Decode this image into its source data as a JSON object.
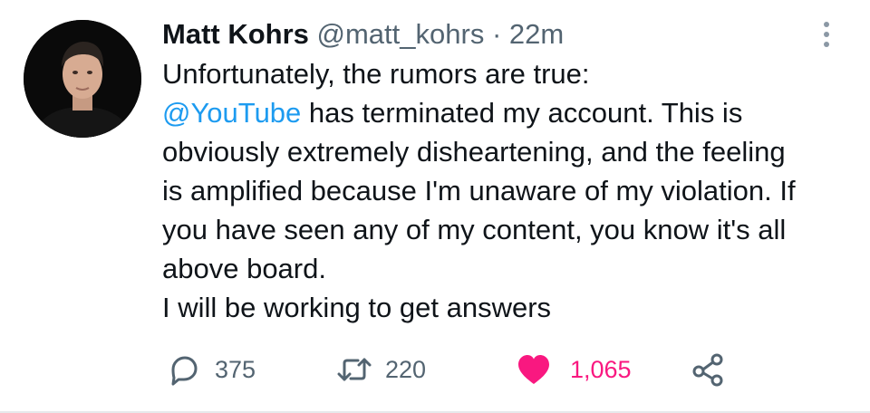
{
  "author": {
    "name": "Matt Kohrs",
    "handle": "@matt_kohrs",
    "separator": "·",
    "time": "22m"
  },
  "tweet": {
    "line1": "Unfortunately, the rumors are true:",
    "mention": "@YouTube",
    "line2_rest": " has terminated my account. This is",
    "line3": "obviously extremely disheartening, and the feeling",
    "line4": "is amplified because I'm unaware of my violation. If",
    "line5": "you have seen any of my content, you know it's all",
    "line6": "above board.",
    "line7": "I will be working to get answers"
  },
  "actions": {
    "replies": "375",
    "retweets": "220",
    "likes": "1,065"
  },
  "icons": {
    "reply": "reply-icon",
    "retweet": "retweet-icon",
    "like": "heart-icon",
    "share": "share-icon",
    "more": "more-options-icon"
  },
  "colors": {
    "mention": "#1d9bf0",
    "like": "#f91880",
    "secondary_text": "#536471"
  }
}
